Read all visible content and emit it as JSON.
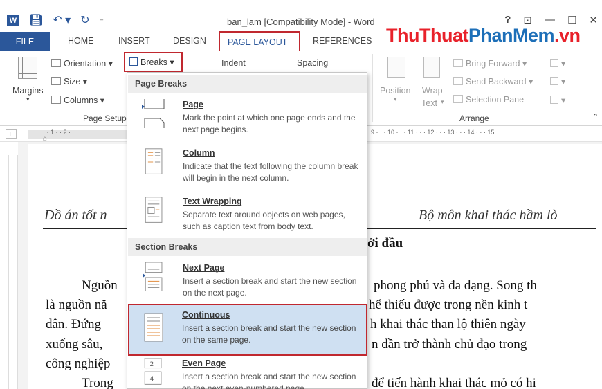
{
  "titlebar": {
    "word_icon": "W",
    "title": "ban_lam [Compatibility Mode] - Word",
    "help": "?",
    "ribbon_display": "⊡",
    "minimize": "—",
    "maximize": "☐",
    "close": "✕"
  },
  "tabs": {
    "file": "FILE",
    "home": "HOME",
    "insert": "INSERT",
    "design": "DESIGN",
    "page_layout": "PAGE LAYOUT",
    "references": "REFERENCES"
  },
  "watermark": {
    "part1": "ThuThuat",
    "part2": "PhanMem",
    "part3": ".vn"
  },
  "ribbon": {
    "margins": "Margins",
    "orientation": "Orientation",
    "size": "Size",
    "columns": "Columns",
    "breaks": "Breaks",
    "indent": "Indent",
    "spacing": "Spacing",
    "page_setup_label": "Page Setup",
    "position": "Position",
    "wrap_text_1": "Wrap",
    "wrap_text_2": "Text",
    "bring_forward": "Bring Forward",
    "send_backward": "Send Backward",
    "selection_pane": "Selection Pane",
    "arrange_label": "Arrange"
  },
  "ruler": {
    "corner": "L",
    "ticks_left": "· · 1 · · 2 ·",
    "ticks_right": "9 · · · 10 · · · 11 · · · 12 · · · 13 · · · 14 · · · 15"
  },
  "menu": {
    "page_breaks_header": "Page Breaks",
    "section_breaks_header": "Section Breaks",
    "items": [
      {
        "title": "Page",
        "desc": "Mark the point at which one page ends and the next page begins."
      },
      {
        "title": "Column",
        "desc": "Indicate that the text following the column break will begin in the next column."
      },
      {
        "title": "Text Wrapping",
        "desc": "Separate text around objects on web pages, such as caption text from body text."
      },
      {
        "title": "Next Page",
        "desc": "Insert a section break and start the new section on the next page."
      },
      {
        "title": "Continuous",
        "desc": "Insert a section break and start the new section on the same page."
      },
      {
        "title": "Even Page",
        "desc": "Insert a section break and start the new section on the next even-numbered page."
      }
    ]
  },
  "document": {
    "header_left": "Đồ án tốt n",
    "header_right": "Bộ môn khai thác hầm lò",
    "heading_fragment": "ởi đầu",
    "lines_left": [
      "Nguồn",
      "là nguồn nă",
      "dân. Đứng",
      "xuống sâu,",
      "công nghiệp",
      "Trong"
    ],
    "lines_right": [
      "phong phú và đa dạng. Song th",
      "hể thiếu được trong nền kinh t",
      "h khai thác than lộ thiên ngày",
      "n dần trở thành chủ đạo trong",
      "",
      "để tiến hành khai thác mỏ có hi"
    ]
  }
}
